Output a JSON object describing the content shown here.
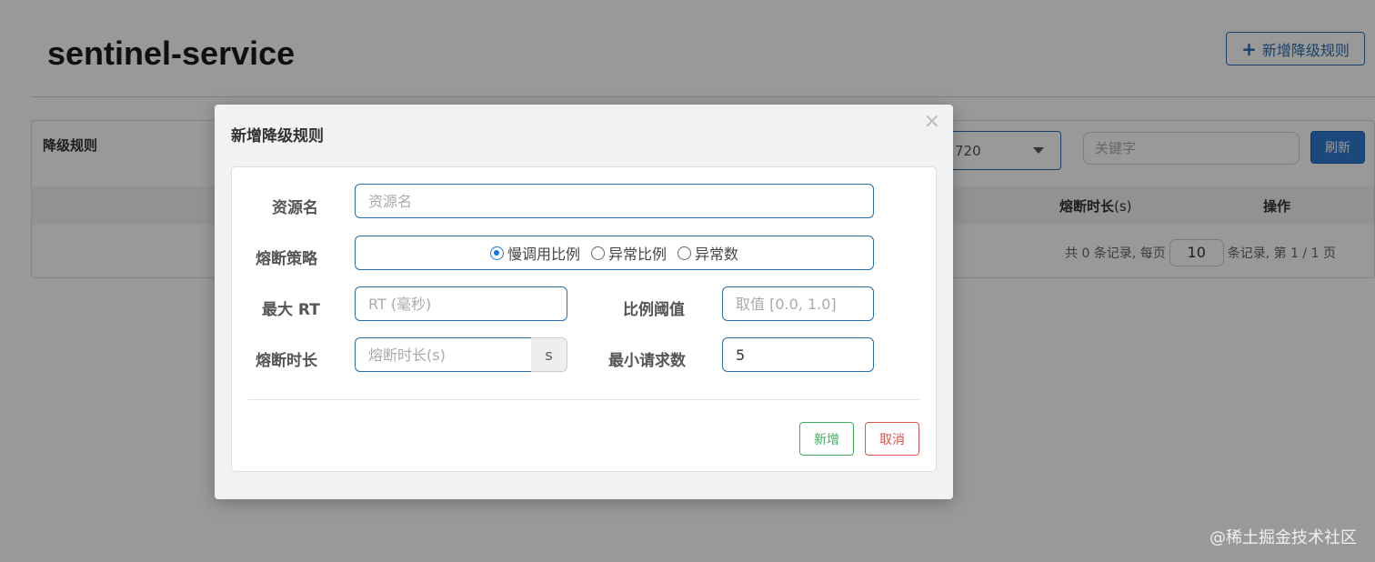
{
  "page": {
    "title": "sentinel-service",
    "add_rule_button": "新增降级规则",
    "add_icon": "plus-icon"
  },
  "panel": {
    "title": "降级规则",
    "machine_select_value": "720",
    "keyword_placeholder": "关键字",
    "refresh_label": "刷新",
    "table_headers": {
      "duration": "熔断时长",
      "duration_unit": "(s)",
      "actions": "操作"
    },
    "pagination": {
      "prefix": "共 0 条记录, 每页",
      "page_size": "10",
      "suffix": "条记录, 第 1 / 1 页"
    }
  },
  "modal": {
    "title": "新增降级规则",
    "close_icon": "×",
    "resource": {
      "label": "资源名",
      "placeholder": "资源名",
      "value": ""
    },
    "strategy": {
      "label": "熔断策略",
      "options": [
        "慢调用比例",
        "异常比例",
        "异常数"
      ],
      "selected": 0
    },
    "max_rt": {
      "label": "最大 RT",
      "placeholder": "RT (毫秒)",
      "value": ""
    },
    "ratio": {
      "label": "比例阈值",
      "placeholder": "取值 [0.0, 1.0]",
      "value": ""
    },
    "duration": {
      "label": "熔断时长",
      "placeholder": "熔断时长(s)",
      "value": "",
      "unit": "s"
    },
    "min_requests": {
      "label": "最小请求数",
      "value": "5"
    },
    "add_button": "新增",
    "cancel_button": "取消"
  },
  "watermark": "@稀土掘金技术社区",
  "colors": {
    "primary": "#2a6dab",
    "refresh": "#2f7ad1",
    "success": "#3fae5a",
    "danger": "#d9534f",
    "radio_checked": "#1a73e8"
  }
}
